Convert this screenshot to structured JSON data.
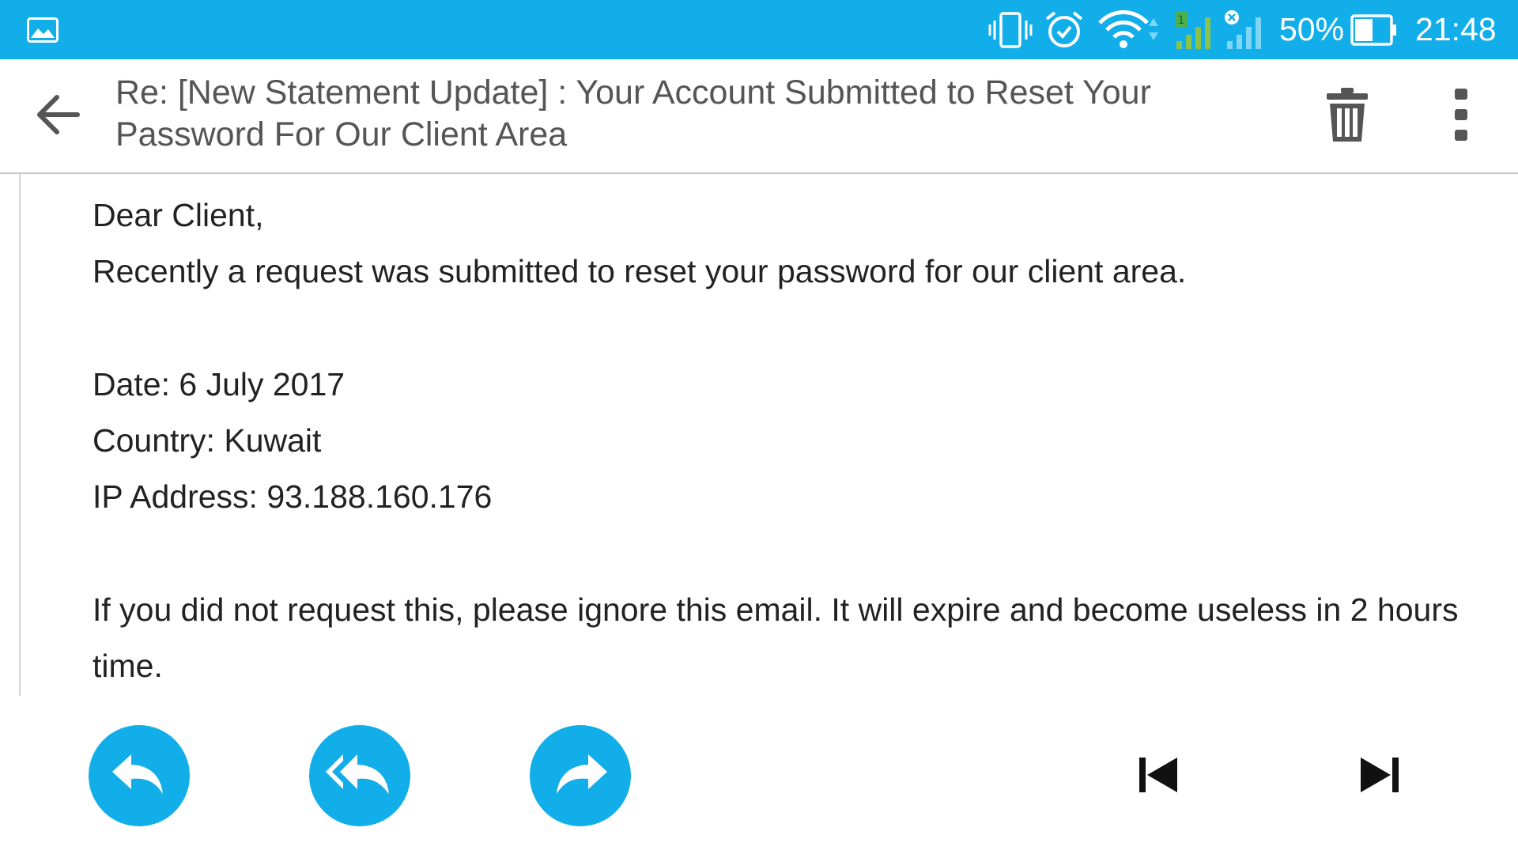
{
  "status_bar": {
    "battery_percent": "50%",
    "time": "21:48",
    "background_color": "#12aee9",
    "icons": [
      "gallery-icon",
      "vibrate-icon",
      "alarm-icon",
      "wifi-icon",
      "sim1-signal-icon",
      "sim2-no-signal-icon",
      "battery-icon"
    ]
  },
  "header": {
    "subject": "Re: [New Statement Update] : Your Account Submitted to Reset Your Password For Our Client Area",
    "icons": [
      "back-arrow-icon",
      "trash-icon",
      "more-vert-icon"
    ]
  },
  "email_body": {
    "greeting": "Dear Client,",
    "intro": "Recently a request was submitted to reset your password for our client area.",
    "date_line": "Date: 6 July 2017",
    "country_line": "Country: Kuwait",
    "ip_line": "IP Address: 93.188.160.176",
    "notice": "If you did not request this, please ignore this email. It will expire and become useless in 2 hours time."
  },
  "bottom_bar": {
    "accent_color": "#12aee9",
    "icons": [
      "reply-icon",
      "reply-all-icon",
      "forward-icon",
      "previous-icon",
      "next-icon"
    ]
  }
}
